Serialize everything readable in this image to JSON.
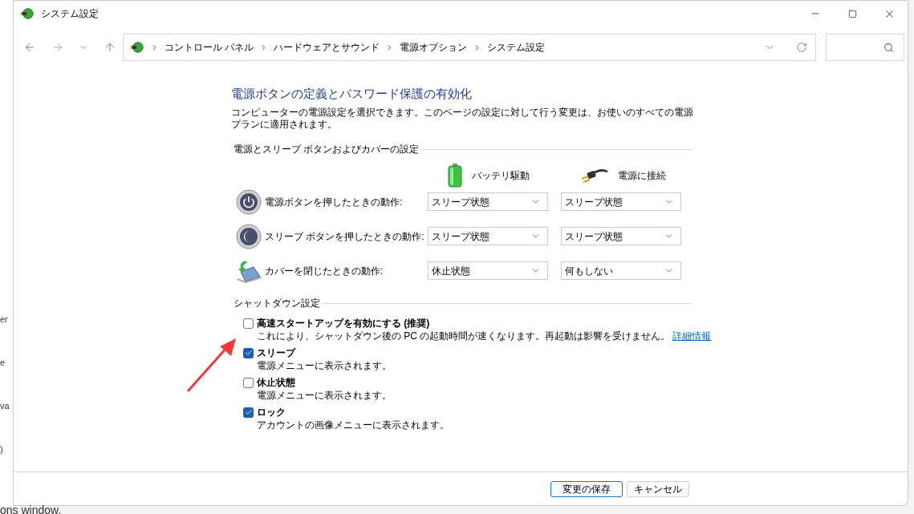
{
  "background_fragments": [
    "er",
    "e",
    "va",
    ")"
  ],
  "background_footer": "ons window.",
  "window": {
    "title": "システム設定"
  },
  "address_bar": {
    "breadcrumbs": [
      "コントロール パネル",
      "ハードウェアとサウンド",
      "電源オプション",
      "システム設定"
    ]
  },
  "page": {
    "heading": "電源ボタンの定義とパスワード保護の有効化",
    "description": "コンピューターの電源設定を選択できます。このページの設定に対して行う変更は、お使いのすべての電源プランに適用されます。"
  },
  "power_section": {
    "title": "電源とスリープ ボタンおよびカバーの設定",
    "columns": [
      {
        "kind": "battery",
        "label": "バッテリ駆動"
      },
      {
        "kind": "plug",
        "label": "電源に接続"
      }
    ],
    "rows": [
      {
        "kind": "power",
        "label": "電源ボタンを押したときの動作:",
        "values": [
          "スリープ状態",
          "スリープ状態"
        ]
      },
      {
        "kind": "sleep",
        "label": "スリープ ボタンを押したときの動作:",
        "values": [
          "スリープ状態",
          "スリープ状態"
        ]
      },
      {
        "kind": "lid",
        "label": "カバーを閉じたときの動作:",
        "values": [
          "休止状態",
          "何もしない"
        ]
      }
    ]
  },
  "shutdown_section": {
    "title": "シャットダウン設定",
    "options": [
      {
        "label": "高速スタートアップを有効にする (推奨)",
        "description": "これにより、シャットダウン後の PC の起動時間が速くなります。再起動は影響を受けません。",
        "link": "詳細情報",
        "checked": false
      },
      {
        "label": "スリープ",
        "description": "電源メニューに表示されます。",
        "checked": true
      },
      {
        "label": "休止状態",
        "description": "電源メニューに表示されます。",
        "checked": false
      },
      {
        "label": "ロック",
        "description": "アカウントの画像メニューに表示されます。",
        "checked": true
      }
    ]
  },
  "buttons": [
    {
      "label": "変更の保存",
      "primary": true
    },
    {
      "label": "キャンセル",
      "primary": false
    }
  ]
}
